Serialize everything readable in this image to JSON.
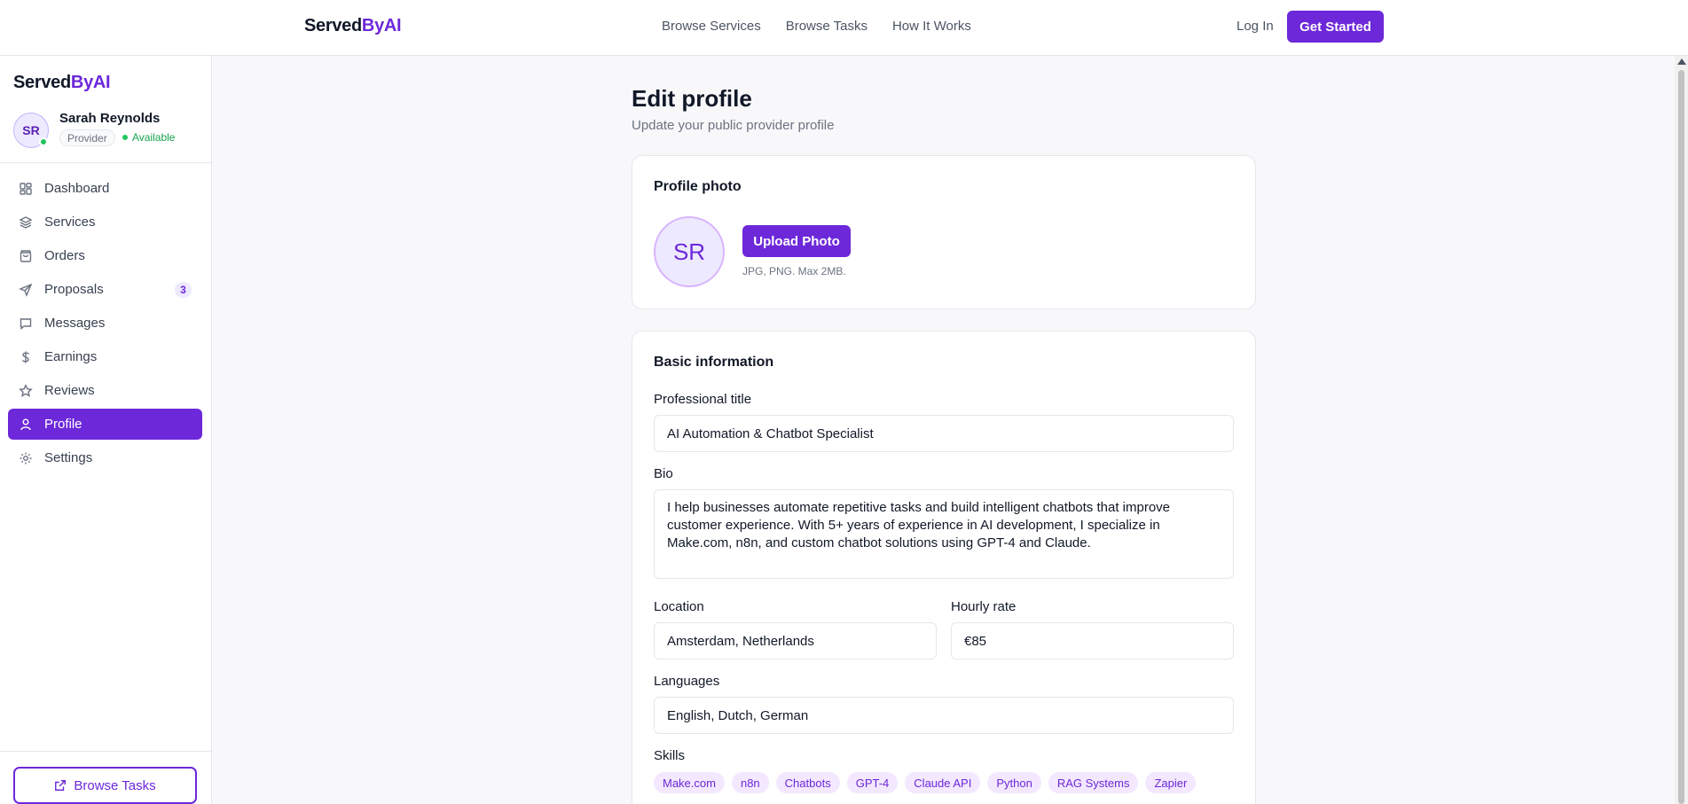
{
  "topbar": {
    "brand_main": "Served",
    "brand_accent": "ByAI",
    "nav": [
      "Browse Services",
      "Browse Tasks",
      "How It Works"
    ],
    "login": "Log In",
    "cta": "Get Started"
  },
  "sidebar": {
    "brand_main": "Served",
    "brand_accent": "ByAI",
    "user": {
      "initials": "SR",
      "name": "Sarah Reynolds",
      "role": "Provider",
      "status": "Available"
    },
    "items": [
      {
        "label": "Dashboard",
        "icon": "dashboard-icon"
      },
      {
        "label": "Services",
        "icon": "layers-icon"
      },
      {
        "label": "Orders",
        "icon": "shopping-bag-icon"
      },
      {
        "label": "Proposals",
        "icon": "send-icon",
        "badge": "3"
      },
      {
        "label": "Messages",
        "icon": "message-icon"
      },
      {
        "label": "Earnings",
        "icon": "dollar-icon"
      },
      {
        "label": "Reviews",
        "icon": "star-icon"
      },
      {
        "label": "Profile",
        "icon": "user-icon",
        "active": true
      },
      {
        "label": "Settings",
        "icon": "gear-icon"
      }
    ],
    "browse_tasks": "Browse Tasks"
  },
  "main": {
    "title": "Edit profile",
    "subtitle": "Update your public provider profile",
    "photo_card": {
      "title": "Profile photo",
      "initials": "SR",
      "upload_label": "Upload Photo",
      "hint": "JPG, PNG. Max 2MB."
    },
    "basic_card": {
      "title": "Basic information",
      "title_label": "Professional title",
      "title_value": "AI Automation & Chatbot Specialist",
      "bio_label": "Bio",
      "bio_value": "I help businesses automate repetitive tasks and build intelligent chatbots that improve customer experience. With 5+ years of experience in AI development, I specialize in Make.com, n8n, and custom chatbot solutions using GPT-4 and Claude.",
      "location_label": "Location",
      "location_value": "Amsterdam, Netherlands",
      "rate_label": "Hourly rate",
      "rate_value": "€85",
      "languages_label": "Languages",
      "languages_value": "English, Dutch, German",
      "skills_label": "Skills",
      "skills": [
        "Make.com",
        "n8n",
        "Chatbots",
        "GPT-4",
        "Claude API",
        "Python",
        "RAG Systems",
        "Zapier"
      ]
    }
  },
  "colors": {
    "accent": "#6d28d9",
    "accent_soft": "#ede9fe",
    "available": "#22c55e"
  }
}
